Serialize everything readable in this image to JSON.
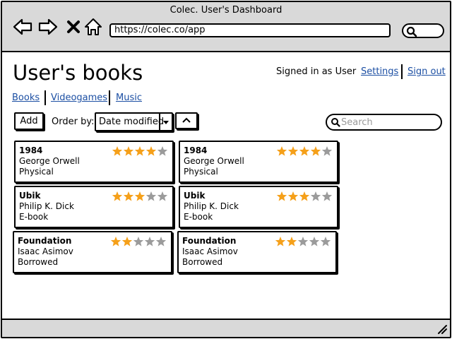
{
  "window": {
    "title": "Colec. User's Dashboard"
  },
  "browser": {
    "url": "https://colec.co/app"
  },
  "page": {
    "title": "User's books"
  },
  "account": {
    "signed_in": "Signed in as User",
    "settings": "Settings",
    "sign_out": "Sign out"
  },
  "tabs": [
    "Books",
    "Videogames",
    "Music"
  ],
  "toolbar": {
    "add": "Add",
    "order_label": "Order by:",
    "order_value": "Date modified",
    "search_placeholder": "Search"
  },
  "colors": {
    "star_on": "#f5a01a",
    "star_off": "#9b9b9b",
    "link": "#1c4fa3"
  },
  "books": [
    {
      "title": "1984",
      "author": "George Orwell",
      "format": "Physical",
      "rating": 4
    },
    {
      "title": "1984",
      "author": "George Orwell",
      "format": "Physical",
      "rating": 4
    },
    {
      "title": "Ubik",
      "author": "Philip K. Dick",
      "format": "E-book",
      "rating": 3
    },
    {
      "title": "Ubik",
      "author": "Philip K. Dick",
      "format": "E-book",
      "rating": 3
    },
    {
      "title": "Foundation",
      "author": "Isaac Asimov",
      "format": "Borrowed",
      "rating": 2
    },
    {
      "title": "Foundation",
      "author": "Isaac Asimov",
      "format": "Borrowed",
      "rating": 2
    }
  ]
}
